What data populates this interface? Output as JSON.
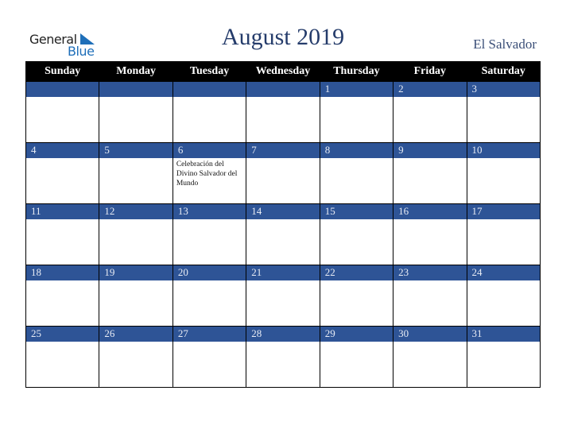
{
  "logo": {
    "line1": "General",
    "line2": "Blue",
    "icon": "triangle-flag-icon",
    "color": "#1f6fb9"
  },
  "title": "August 2019",
  "country": "El Salvador",
  "colors": {
    "header_bg": "#000000",
    "band": "#2e5496",
    "title": "#253c6b"
  },
  "weekdays": [
    "Sunday",
    "Monday",
    "Tuesday",
    "Wednesday",
    "Thursday",
    "Friday",
    "Saturday"
  ],
  "weeks": [
    [
      {
        "day": ""
      },
      {
        "day": ""
      },
      {
        "day": ""
      },
      {
        "day": ""
      },
      {
        "day": "1"
      },
      {
        "day": "2"
      },
      {
        "day": "3"
      }
    ],
    [
      {
        "day": "4"
      },
      {
        "day": "5"
      },
      {
        "day": "6",
        "event": "Celebración del Divino Salvador del Mundo"
      },
      {
        "day": "7"
      },
      {
        "day": "8"
      },
      {
        "day": "9"
      },
      {
        "day": "10"
      }
    ],
    [
      {
        "day": "11"
      },
      {
        "day": "12"
      },
      {
        "day": "13"
      },
      {
        "day": "14"
      },
      {
        "day": "15"
      },
      {
        "day": "16"
      },
      {
        "day": "17"
      }
    ],
    [
      {
        "day": "18"
      },
      {
        "day": "19"
      },
      {
        "day": "20"
      },
      {
        "day": "21"
      },
      {
        "day": "22"
      },
      {
        "day": "23"
      },
      {
        "day": "24"
      }
    ],
    [
      {
        "day": "25"
      },
      {
        "day": "26"
      },
      {
        "day": "27"
      },
      {
        "day": "28"
      },
      {
        "day": "29"
      },
      {
        "day": "30"
      },
      {
        "day": "31"
      }
    ]
  ]
}
